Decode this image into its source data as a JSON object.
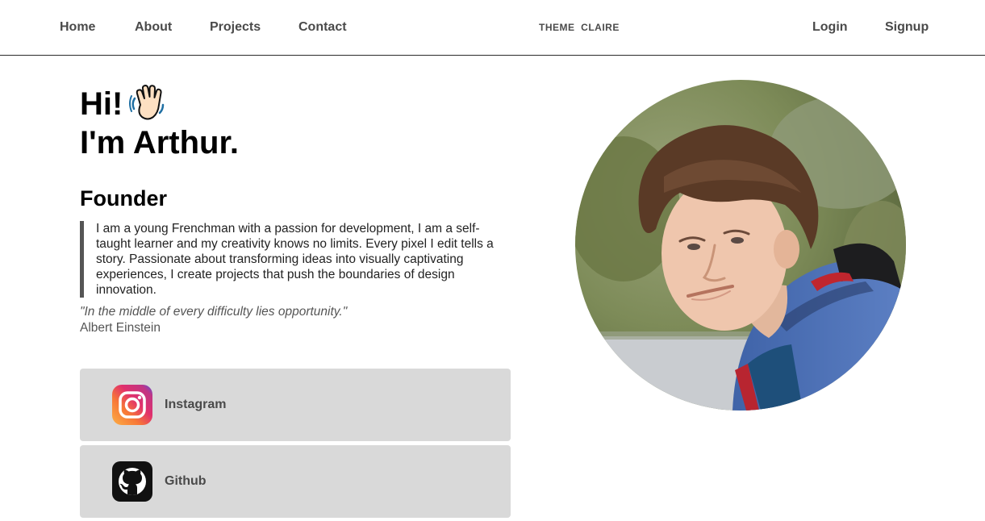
{
  "nav": {
    "left": [
      "Home",
      "About",
      "Projects",
      "Contact"
    ],
    "brand": "THEME  CLAIRE",
    "right": [
      "Login",
      "Signup"
    ]
  },
  "hero": {
    "greeting_line1": "Hi!",
    "greeting_line2": "I'm Arthur.",
    "wave_icon": "waving-hand-icon",
    "role": "Founder",
    "bio": "I am a young Frenchman with a passion for development, I am a self-taught learner and my creativity knows no limits. Every pixel I edit tells a story. Passionate about transforming ideas into visually captivating experiences, I create projects that push the boundaries of design innovation.",
    "quote": "\"In the middle of every difficulty lies opportunity.\"",
    "quote_author": "Albert Einstein"
  },
  "socials": [
    {
      "label": "Instagram",
      "icon": "instagram-icon"
    },
    {
      "label": "Github",
      "icon": "github-icon"
    }
  ],
  "colors": {
    "nav_text": "#4a4a4a",
    "card_bg": "#d9d9d9",
    "bio_border": "#555555"
  }
}
